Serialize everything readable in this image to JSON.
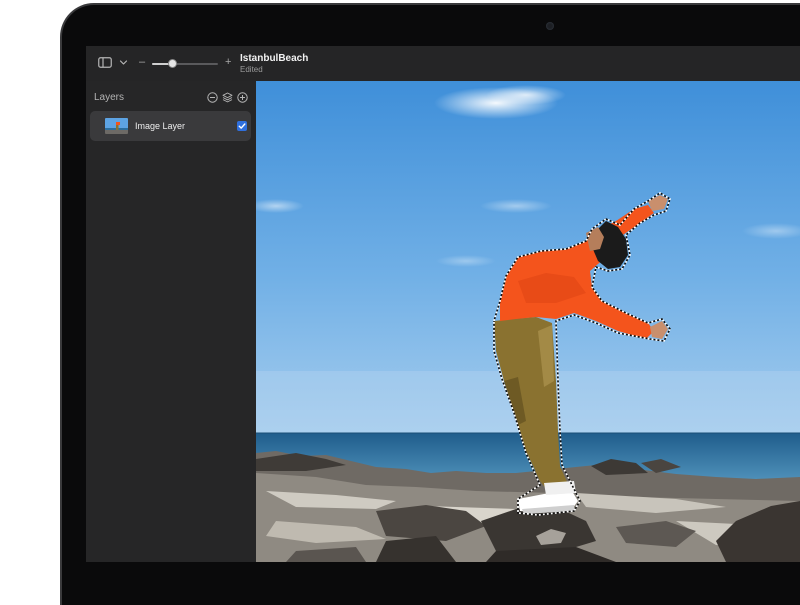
{
  "toolbar": {
    "zoom_minus": "–",
    "zoom_plus": "+",
    "zoom_level": 0.3,
    "document_title": "IstanbulBeach",
    "document_status": "Edited"
  },
  "sidebar": {
    "title": "Layers",
    "icons": [
      "minus-circle-icon",
      "layers-stack-icon",
      "plus-circle-icon"
    ],
    "layers": [
      {
        "name": "Image Layer",
        "visible": true
      }
    ]
  },
  "colors": {
    "accent": "#2f6fdd",
    "shirt": "#f4541c",
    "pants": "#8a7230",
    "sky_top": "#3f8fd9",
    "sea": "#2d6e9e"
  }
}
